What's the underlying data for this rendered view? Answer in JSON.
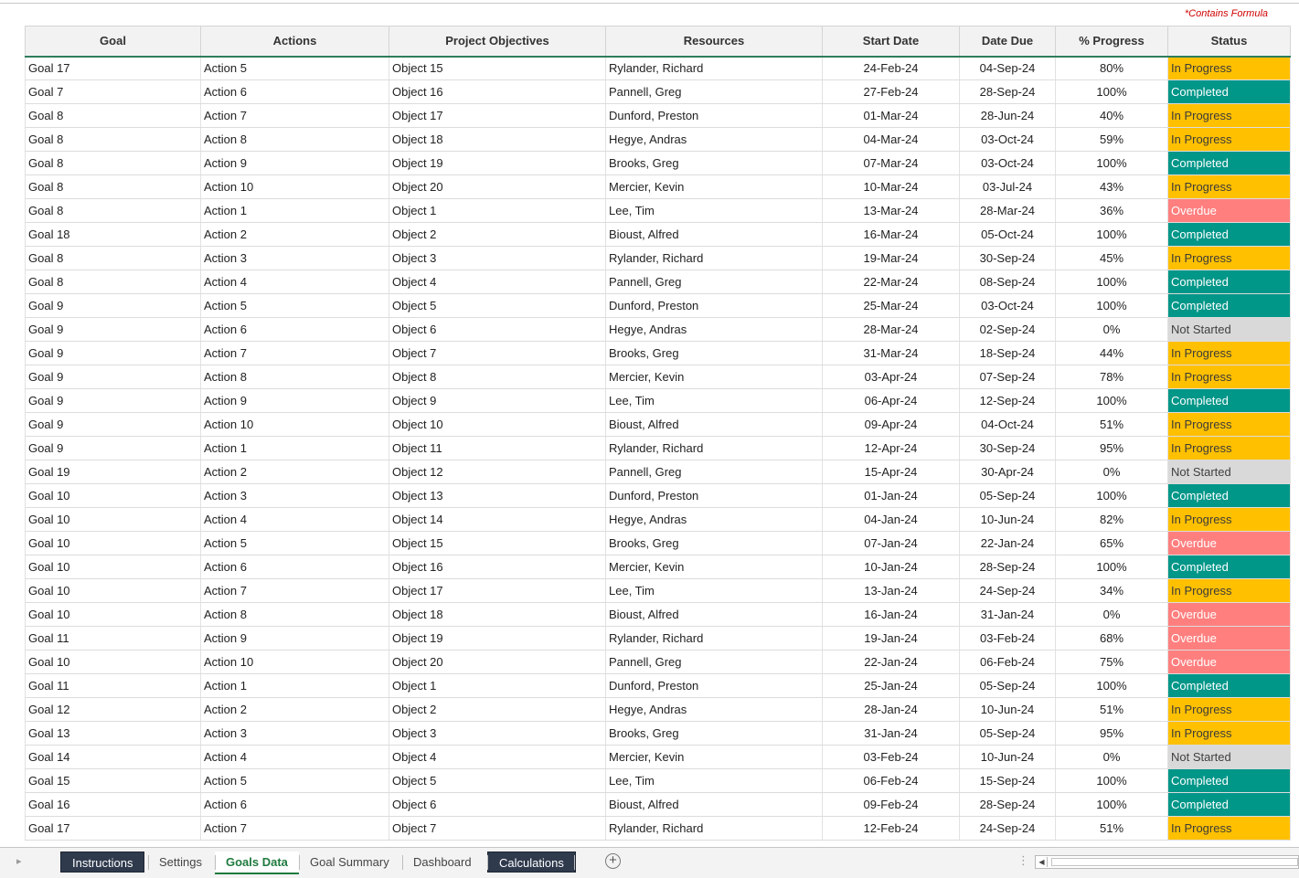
{
  "formula_note": "*Contains Formula",
  "table": {
    "headers": [
      "Goal",
      "Actions",
      "Project Objectives",
      "Resources",
      "Start Date",
      "Date Due",
      "% Progress",
      "Status"
    ],
    "rows": [
      [
        "Goal 17",
        "Action 5",
        "Object 15",
        "Rylander, Richard",
        "24-Feb-24",
        "04-Sep-24",
        "80%",
        "In Progress"
      ],
      [
        "Goal 7",
        "Action 6",
        "Object 16",
        "Pannell, Greg",
        "27-Feb-24",
        "28-Sep-24",
        "100%",
        "Completed"
      ],
      [
        "Goal 8",
        "Action 7",
        "Object 17",
        "Dunford, Preston",
        "01-Mar-24",
        "28-Jun-24",
        "40%",
        "In Progress"
      ],
      [
        "Goal 8",
        "Action 8",
        "Object 18",
        "Hegye, Andras",
        "04-Mar-24",
        "03-Oct-24",
        "59%",
        "In Progress"
      ],
      [
        "Goal 8",
        "Action 9",
        "Object 19",
        "Brooks, Greg",
        "07-Mar-24",
        "03-Oct-24",
        "100%",
        "Completed"
      ],
      [
        "Goal 8",
        "Action 10",
        "Object 20",
        "Mercier, Kevin",
        "10-Mar-24",
        "03-Jul-24",
        "43%",
        "In Progress"
      ],
      [
        "Goal 8",
        "Action 1",
        "Object 1",
        "Lee, Tim",
        "13-Mar-24",
        "28-Mar-24",
        "36%",
        "Overdue"
      ],
      [
        "Goal 18",
        "Action 2",
        "Object 2",
        "Bioust, Alfred",
        "16-Mar-24",
        "05-Oct-24",
        "100%",
        "Completed"
      ],
      [
        "Goal 8",
        "Action 3",
        "Object 3",
        "Rylander, Richard",
        "19-Mar-24",
        "30-Sep-24",
        "45%",
        "In Progress"
      ],
      [
        "Goal 8",
        "Action 4",
        "Object 4",
        "Pannell, Greg",
        "22-Mar-24",
        "08-Sep-24",
        "100%",
        "Completed"
      ],
      [
        "Goal 9",
        "Action 5",
        "Object 5",
        "Dunford, Preston",
        "25-Mar-24",
        "03-Oct-24",
        "100%",
        "Completed"
      ],
      [
        "Goal 9",
        "Action 6",
        "Object 6",
        "Hegye, Andras",
        "28-Mar-24",
        "02-Sep-24",
        "0%",
        "Not Started"
      ],
      [
        "Goal 9",
        "Action 7",
        "Object 7",
        "Brooks, Greg",
        "31-Mar-24",
        "18-Sep-24",
        "44%",
        "In Progress"
      ],
      [
        "Goal 9",
        "Action 8",
        "Object 8",
        "Mercier, Kevin",
        "03-Apr-24",
        "07-Sep-24",
        "78%",
        "In Progress"
      ],
      [
        "Goal 9",
        "Action 9",
        "Object 9",
        "Lee, Tim",
        "06-Apr-24",
        "12-Sep-24",
        "100%",
        "Completed"
      ],
      [
        "Goal 9",
        "Action 10",
        "Object 10",
        "Bioust, Alfred",
        "09-Apr-24",
        "04-Oct-24",
        "51%",
        "In Progress"
      ],
      [
        "Goal 9",
        "Action 1",
        "Object 11",
        "Rylander, Richard",
        "12-Apr-24",
        "30-Sep-24",
        "95%",
        "In Progress"
      ],
      [
        "Goal 19",
        "Action 2",
        "Object 12",
        "Pannell, Greg",
        "15-Apr-24",
        "30-Apr-24",
        "0%",
        "Not Started"
      ],
      [
        "Goal 10",
        "Action 3",
        "Object 13",
        "Dunford, Preston",
        "01-Jan-24",
        "05-Sep-24",
        "100%",
        "Completed"
      ],
      [
        "Goal 10",
        "Action 4",
        "Object 14",
        "Hegye, Andras",
        "04-Jan-24",
        "10-Jun-24",
        "82%",
        "In Progress"
      ],
      [
        "Goal 10",
        "Action 5",
        "Object 15",
        "Brooks, Greg",
        "07-Jan-24",
        "22-Jan-24",
        "65%",
        "Overdue"
      ],
      [
        "Goal 10",
        "Action 6",
        "Object 16",
        "Mercier, Kevin",
        "10-Jan-24",
        "28-Sep-24",
        "100%",
        "Completed"
      ],
      [
        "Goal 10",
        "Action 7",
        "Object 17",
        "Lee, Tim",
        "13-Jan-24",
        "24-Sep-24",
        "34%",
        "In Progress"
      ],
      [
        "Goal 10",
        "Action 8",
        "Object 18",
        "Bioust, Alfred",
        "16-Jan-24",
        "31-Jan-24",
        "0%",
        "Overdue"
      ],
      [
        "Goal 11",
        "Action 9",
        "Object 19",
        "Rylander, Richard",
        "19-Jan-24",
        "03-Feb-24",
        "68%",
        "Overdue"
      ],
      [
        "Goal 10",
        "Action 10",
        "Object 20",
        "Pannell, Greg",
        "22-Jan-24",
        "06-Feb-24",
        "75%",
        "Overdue"
      ],
      [
        "Goal 11",
        "Action 1",
        "Object 1",
        "Dunford, Preston",
        "25-Jan-24",
        "05-Sep-24",
        "100%",
        "Completed"
      ],
      [
        "Goal 12",
        "Action 2",
        "Object 2",
        "Hegye, Andras",
        "28-Jan-24",
        "10-Jun-24",
        "51%",
        "In Progress"
      ],
      [
        "Goal 13",
        "Action 3",
        "Object 3",
        "Brooks, Greg",
        "31-Jan-24",
        "05-Sep-24",
        "95%",
        "In Progress"
      ],
      [
        "Goal 14",
        "Action 4",
        "Object 4",
        "Mercier, Kevin",
        "03-Feb-24",
        "10-Jun-24",
        "0%",
        "Not Started"
      ],
      [
        "Goal 15",
        "Action 5",
        "Object 5",
        "Lee, Tim",
        "06-Feb-24",
        "15-Sep-24",
        "100%",
        "Completed"
      ],
      [
        "Goal 16",
        "Action 6",
        "Object 6",
        "Bioust, Alfred",
        "09-Feb-24",
        "28-Sep-24",
        "100%",
        "Completed"
      ],
      [
        "Goal 17",
        "Action 7",
        "Object 7",
        "Rylander, Richard",
        "12-Feb-24",
        "24-Sep-24",
        "51%",
        "In Progress"
      ]
    ]
  },
  "status_colors": {
    "In Progress": "#ffc000",
    "Completed": "#009688",
    "Overdue": "#ff7f7f",
    "Not Started": "#d9d9d9"
  },
  "tabs": [
    {
      "label": "Instructions",
      "style": "dark"
    },
    {
      "label": "Settings",
      "style": "normal"
    },
    {
      "label": "Goals Data",
      "style": "active"
    },
    {
      "label": "Goal Summary",
      "style": "normal"
    },
    {
      "label": "Dashboard",
      "style": "normal"
    },
    {
      "label": "Calculations",
      "style": "dark"
    }
  ],
  "icons": {
    "add_sheet": "plus-circle-icon",
    "scroll_left": "triangle-left-icon",
    "tab_nav": "chevron-right-icon",
    "more": "vertical-dots-icon"
  }
}
